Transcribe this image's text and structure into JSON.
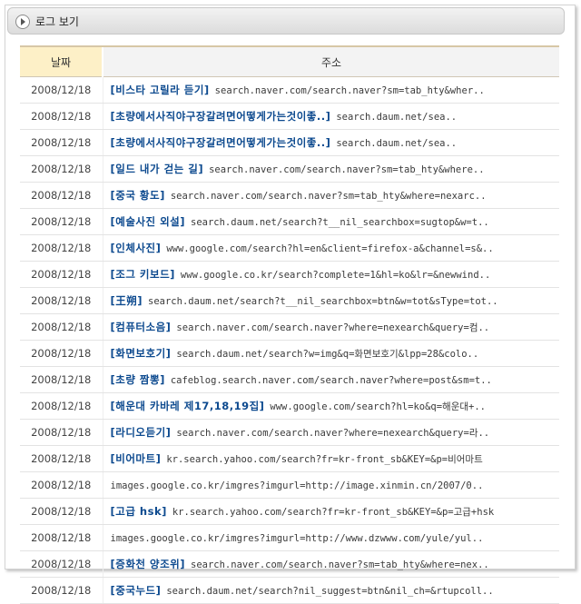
{
  "panel": {
    "title": "로그 보기"
  },
  "table": {
    "headers": {
      "date": "날짜",
      "address": "주소"
    },
    "rows": [
      {
        "date": "2008/12/18",
        "keyword": "[비스타 고릴라 듣기]",
        "url": "search.naver.com/search.naver?sm=tab_hty&wher.."
      },
      {
        "date": "2008/12/18",
        "keyword": "[초량에서사직야구장갈려면어떻게가는것이좋..]",
        "url": "search.daum.net/sea.."
      },
      {
        "date": "2008/12/18",
        "keyword": "[초량에서사직야구장갈려면어떻게가는것이좋..]",
        "url": "search.daum.net/sea.."
      },
      {
        "date": "2008/12/18",
        "keyword": "[일드 내가 걷는 길]",
        "url": "search.naver.com/search.naver?sm=tab_hty&where.."
      },
      {
        "date": "2008/12/18",
        "keyword": "[중국 황도]",
        "url": "search.naver.com/search.naver?sm=tab_hty&where=nexarc.."
      },
      {
        "date": "2008/12/18",
        "keyword": "[예술사진 외설]",
        "url": "search.daum.net/search?t__nil_searchbox=sugtop&w=t.."
      },
      {
        "date": "2008/12/18",
        "keyword": "[인체사진]",
        "url": "www.google.com/search?hl=en&client=firefox-a&channel=s&.."
      },
      {
        "date": "2008/12/18",
        "keyword": "[조그 키보드]",
        "url": "www.google.co.kr/search?complete=1&hl=ko&lr=&newwind.."
      },
      {
        "date": "2008/12/18",
        "keyword": "[王朔]",
        "url": "search.daum.net/search?t__nil_searchbox=btn&w=tot&sType=tot.."
      },
      {
        "date": "2008/12/18",
        "keyword": "[컴퓨터소음]",
        "url": "search.naver.com/search.naver?where=nexearch&query=컴.."
      },
      {
        "date": "2008/12/18",
        "keyword": "[화면보호기]",
        "url": "search.daum.net/search?w=img&q=화면보호기&lpp=28&colo.."
      },
      {
        "date": "2008/12/18",
        "keyword": "[초량 짬뽕]",
        "url": "cafeblog.search.naver.com/search.naver?where=post&sm=t.."
      },
      {
        "date": "2008/12/18",
        "keyword": "[해운대 카바레 제17,18,19집]",
        "url": "www.google.com/search?hl=ko&q=해운대+.."
      },
      {
        "date": "2008/12/18",
        "keyword": "[라디오듣기]",
        "url": "search.naver.com/search.naver?where=nexearch&query=라.."
      },
      {
        "date": "2008/12/18",
        "keyword": "[비어마트]",
        "url": "kr.search.yahoo.com/search?fr=kr-front_sb&KEY=&p=비어마트"
      },
      {
        "date": "2008/12/18",
        "keyword": "",
        "url": "images.google.co.kr/imgres?imgurl=http://image.xinmin.cn/2007/0.."
      },
      {
        "date": "2008/12/18",
        "keyword": "[고급 hsk]",
        "url": "kr.search.yahoo.com/search?fr=kr-front_sb&KEY=&p=고급+hsk"
      },
      {
        "date": "2008/12/18",
        "keyword": "",
        "url": "images.google.co.kr/imgres?imgurl=http://www.dzwww.com/yule/yul.."
      },
      {
        "date": "2008/12/18",
        "keyword": "[증화천 양조위]",
        "url": "search.naver.com/search.naver?sm=tab_hty&where=nex.."
      },
      {
        "date": "2008/12/18",
        "keyword": "[중국누드]",
        "url": "search.daum.net/search?nil_suggest=btn&nil_ch=&rtupcoll.."
      }
    ]
  }
}
